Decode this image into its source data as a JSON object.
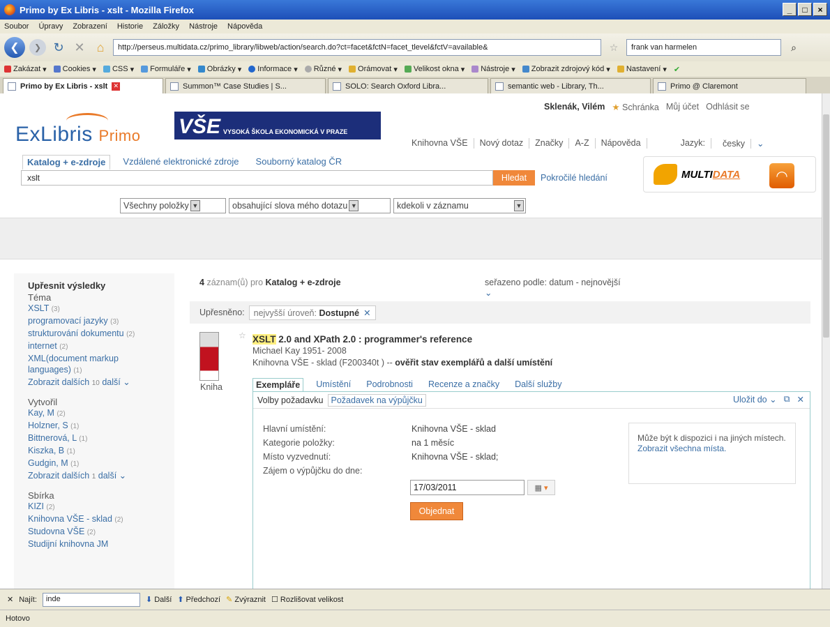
{
  "window": {
    "title": "Primo by Ex Libris - xslt - Mozilla Firefox"
  },
  "menu": [
    "Soubor",
    "Úpravy",
    "Zobrazení",
    "Historie",
    "Záložky",
    "Nástroje",
    "Nápověda"
  ],
  "nav": {
    "url": "http://perseus.multidata.cz/primo_library/libweb/action/search.do?ct=facet&fctN=facet_tlevel&fctV=available&",
    "search_value": "frank van harmelen"
  },
  "bookmarks": [
    "Zakázat",
    "Cookies",
    "CSS",
    "Formuláře",
    "Obrázky",
    "Informace",
    "Různé",
    "Orámovat",
    "Velikost okna",
    "Nástroje",
    "Zobrazit zdrojový kód",
    "Nastavení"
  ],
  "tabs": [
    {
      "label": "Primo by Ex Libris - xslt"
    },
    {
      "label": "Summon™ Case Studies | S..."
    },
    {
      "label": "SOLO: Search Oxford Libra..."
    },
    {
      "label": "semantic web - Library, Th..."
    },
    {
      "label": "Primo @ Claremont"
    }
  ],
  "user": {
    "name": "Sklenák, Vilém",
    "schranka": "Schránka",
    "account": "Můj účet",
    "logout": "Odhlásit se"
  },
  "brand": {
    "exlibris": "ExLibris",
    "primo": "Primo",
    "vse_big": "VŠE",
    "vse_small": "VYSOKÁ ŠKOLA EKONOMICKÁ V PRAZE"
  },
  "topnav": [
    "Knihovna VŠE",
    "Nový dotaz",
    "Značky",
    "A-Z",
    "Nápověda",
    "Jazyk:",
    "česky"
  ],
  "scope_tabs": [
    "Katalog + e-zdroje",
    "Vzdálené elektronické zdroje",
    "Souborný katalog ČR"
  ],
  "search": {
    "query": "xslt",
    "button": "Hledat",
    "advanced": "Pokročilé hledání"
  },
  "multidata": {
    "left": "MULTI",
    "right": "DATA"
  },
  "selects": [
    "Všechny položky",
    "obsahující slova mého dotazu",
    "kdekoli v záznamu"
  ],
  "facets": {
    "title": "Upřesnit výsledky",
    "tema_h": "Téma",
    "tema": [
      {
        "label": "XSLT",
        "count": "(3)"
      },
      {
        "label": "programovací jazyky",
        "count": "(3)"
      },
      {
        "label": "strukturování dokumentu",
        "count": "(2)"
      },
      {
        "label": "internet",
        "count": "(2)"
      },
      {
        "label": "XML(document markup languages)",
        "count": "(1)"
      }
    ],
    "tema_more": {
      "label": "Zobrazit dalších",
      "n": "10",
      "more": "další"
    },
    "vytvoril_h": "Vytvořil",
    "vytvoril": [
      {
        "label": "Kay, M",
        "count": "(2)"
      },
      {
        "label": "Holzner, S",
        "count": "(1)"
      },
      {
        "label": "Bittnerová, L",
        "count": "(1)"
      },
      {
        "label": "Kiszka, B",
        "count": "(1)"
      },
      {
        "label": "Gudgin, M",
        "count": "(1)"
      }
    ],
    "vytvoril_more": {
      "label": "Zobrazit dalších",
      "n": "1",
      "more": "další"
    },
    "sbirka_h": "Sbírka",
    "sbirka": [
      {
        "label": "KIZI",
        "count": "(2)"
      },
      {
        "label": "Knihovna VŠE - sklad",
        "count": "(2)"
      },
      {
        "label": "Studovna VŠE",
        "count": "(2)"
      },
      {
        "label": "Studijní knihovna JM",
        "count": ""
      }
    ]
  },
  "results": {
    "count": "4",
    "count_text": "záznam(ů) pro",
    "scope": "Katalog + e-zdroje",
    "sort_label": "seřazeno podle: datum - nejnovější",
    "refined_label": "Upřesněno:",
    "refined_chip_pre": "nejvyšší úroveň:",
    "refined_chip_val": "Dostupné",
    "item": {
      "type": "Kniha",
      "title_hl": "XSLT",
      "title_rest": " 2.0 and XPath 2.0 : programmer's reference",
      "author": "Michael Kay 1951- 2008",
      "location": "Knihovna VŠE - sklad  (F200340t ) --",
      "location_link": "ověřit stav exemplářů a další umístění",
      "tabs": [
        "Exempláře",
        "Umístění",
        "Podrobnosti",
        "Recenze a značky",
        "Další služby"
      ],
      "panel": {
        "opt1": "Volby požadavku",
        "opt2": "Požadavek na výpůjčku",
        "save": "Uložit do",
        "rows": [
          {
            "k": "Hlavní umístění:",
            "v": "Knihovna VŠE - sklad"
          },
          {
            "k": "Kategorie položky:",
            "v": "na 1 měsíc"
          },
          {
            "k": "Místo vyzvednutí:",
            "v": "Knihovna VŠE - sklad;"
          },
          {
            "k": "Zájem o výpůjčku do dne:",
            "v": ""
          }
        ],
        "date": "17/03/2011",
        "order": "Objednat",
        "avail_text": "Může být k dispozici i na jiných místech.",
        "avail_link": "Zobrazit všechna místa."
      }
    }
  },
  "findbar": {
    "label": "Najít:",
    "value": "inde",
    "next": "Další",
    "prev": "Předchozí",
    "highlight": "Zvýraznit",
    "case": "Rozlišovat velikost"
  },
  "status": "Hotovo"
}
